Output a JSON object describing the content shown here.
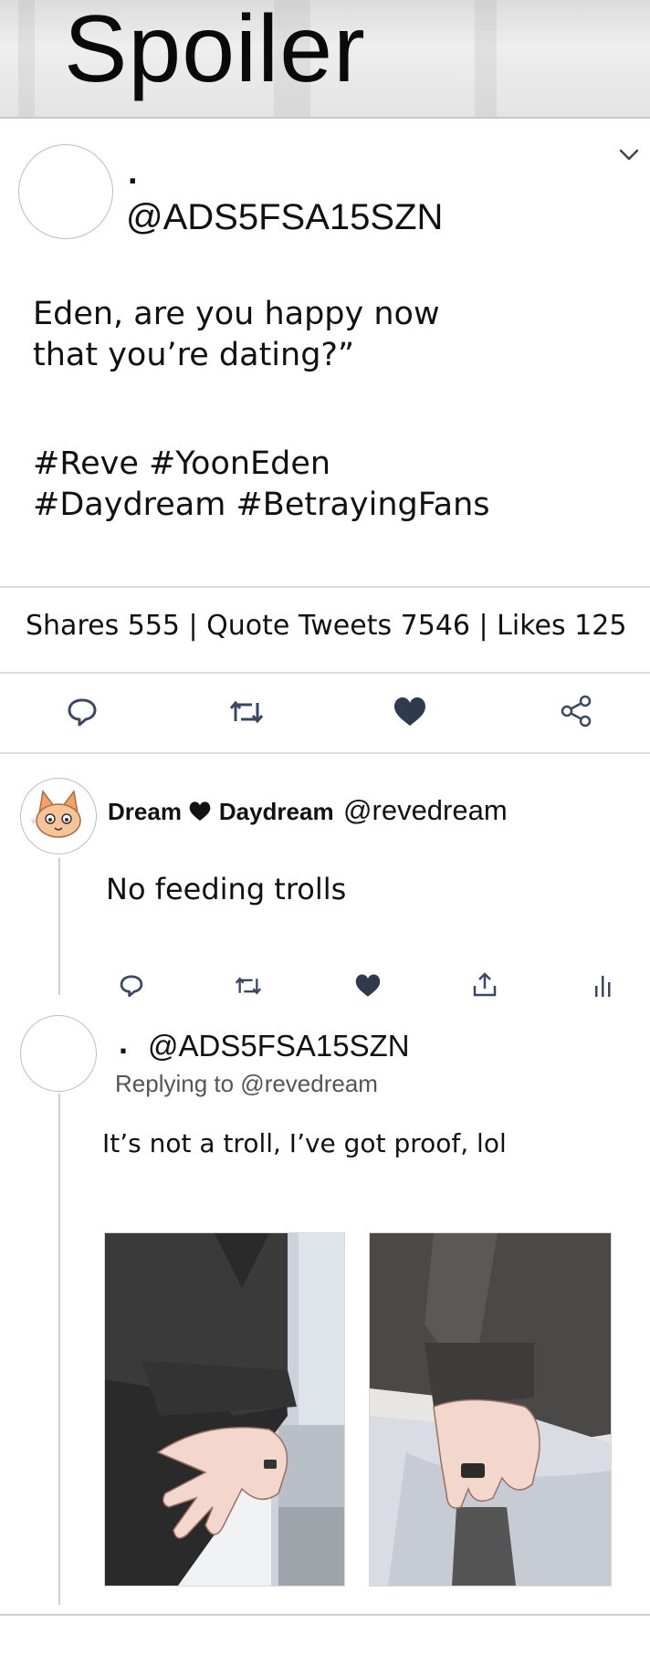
{
  "banner": {
    "title": "Spoiler"
  },
  "main_tweet": {
    "display_name": ".",
    "handle": "@ADS5FSA15SZN",
    "text_lines": [
      "Eden, are you happy now",
      "that you’re dating?”"
    ],
    "hashtag_lines": [
      "#Reve #YoonEden",
      "#Daydream #BetrayingFans"
    ],
    "stats": "Shares 555 | Quote Tweets 7546 | Likes 125",
    "actions": [
      "reply-icon",
      "retweet-icon",
      "heart-icon",
      "share-icon"
    ]
  },
  "reply1": {
    "name_part1": "Dream",
    "name_part2": "Daydream",
    "handle": "@revedream",
    "text": "No feeding trolls",
    "actions": [
      "reply-icon",
      "retweet-icon",
      "heart-icon",
      "upload-icon",
      "analytics-icon"
    ]
  },
  "reply2": {
    "display_name": ".",
    "handle": "@ADS5FSA15SZN",
    "replying_to": "Replying to @revedream",
    "text": "It’s not a troll, I’ve got proof, lol",
    "images": [
      "hands-photo-left",
      "hands-photo-right"
    ]
  },
  "colors": {
    "heart": "#2f3a4f",
    "icon_outline": "#3b4763",
    "divider": "#dcdcdc"
  }
}
